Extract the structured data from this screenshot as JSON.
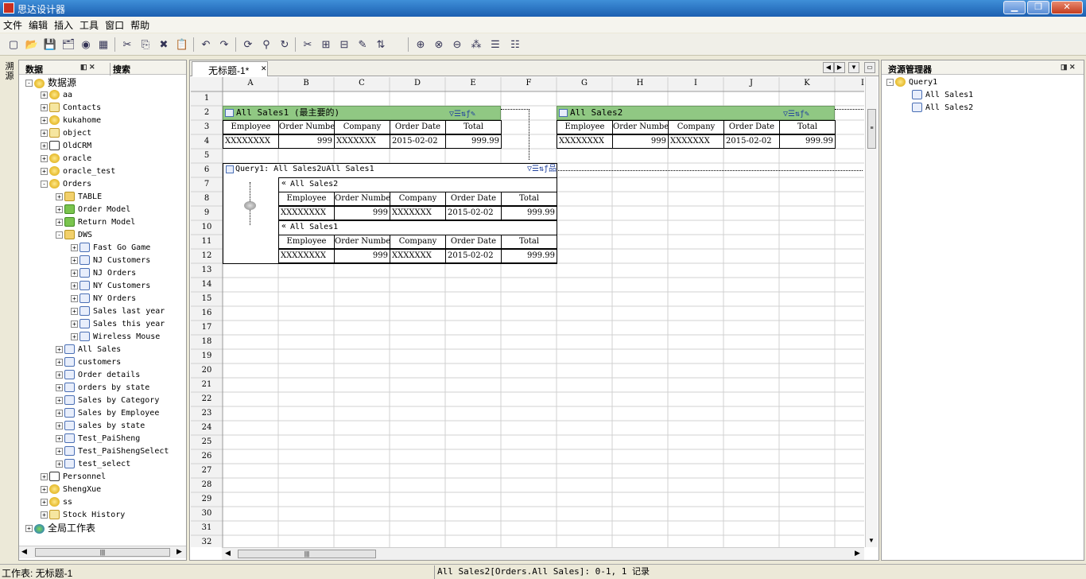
{
  "window": {
    "title": "思达设计器",
    "min_label": "▁",
    "max_label": "❐",
    "close_label": "✕"
  },
  "menu": [
    "文件",
    "编辑",
    "插入",
    "工具",
    "窗口",
    "帮助"
  ],
  "toolbar": [
    "new-icon",
    "open-icon",
    "save-icon",
    "save-all-icon",
    "preview-icon",
    "print-icon",
    "cut-icon",
    "copy-icon",
    "delete-icon",
    "paste-icon",
    "undo-icon",
    "redo-icon",
    "refresh-icon",
    "tree-icon",
    "reload-icon",
    "filter-icon",
    "grid-add-icon",
    "grid-sub-icon",
    "grid-edit-icon",
    "grid-sort-icon",
    "union-icon",
    "intersect-icon",
    "minus-icon",
    "split-icon",
    "table-icon",
    "table2-icon"
  ],
  "left_sidetab": "溯源",
  "data_panel": {
    "tab_data": "数据",
    "tab_search": "搜索",
    "tree": [
      {
        "l": 0,
        "e": "-",
        "i": "db",
        "t": "数据源"
      },
      {
        "l": 1,
        "e": "+",
        "i": "db",
        "t": "aa"
      },
      {
        "l": 1,
        "e": "+",
        "i": "ct",
        "t": "Contacts"
      },
      {
        "l": 1,
        "e": "+",
        "i": "db",
        "t": "kukahome"
      },
      {
        "l": 1,
        "e": "+",
        "i": "ct",
        "t": "object"
      },
      {
        "l": 1,
        "e": "+",
        "i": "xl",
        "t": "OldCRM"
      },
      {
        "l": 1,
        "e": "+",
        "i": "db",
        "t": "oracle"
      },
      {
        "l": 1,
        "e": "+",
        "i": "db",
        "t": "oracle_test"
      },
      {
        "l": 1,
        "e": "-",
        "i": "db",
        "t": "Orders"
      },
      {
        "l": 2,
        "e": "+",
        "i": "fo",
        "t": "TABLE"
      },
      {
        "l": 2,
        "e": "+",
        "i": "fg",
        "t": "Order Model"
      },
      {
        "l": 2,
        "e": "+",
        "i": "fg",
        "t": "Return Model"
      },
      {
        "l": 2,
        "e": "-",
        "i": "fo",
        "t": "DWS"
      },
      {
        "l": 3,
        "e": "+",
        "i": "tb2",
        "t": "Fast Go Game"
      },
      {
        "l": 3,
        "e": "+",
        "i": "tb2",
        "t": "NJ Customers"
      },
      {
        "l": 3,
        "e": "+",
        "i": "tb2",
        "t": "NJ Orders"
      },
      {
        "l": 3,
        "e": "+",
        "i": "tb2",
        "t": "NY Customers"
      },
      {
        "l": 3,
        "e": "+",
        "i": "tb2",
        "t": "NY Orders"
      },
      {
        "l": 3,
        "e": "+",
        "i": "tb2",
        "t": "Sales last year"
      },
      {
        "l": 3,
        "e": "+",
        "i": "tb2",
        "t": "Sales this year"
      },
      {
        "l": 3,
        "e": "+",
        "i": "tb2",
        "t": "Wireless Mouse"
      },
      {
        "l": 2,
        "e": "+",
        "i": "tb2",
        "t": "All Sales"
      },
      {
        "l": 2,
        "e": "+",
        "i": "tb2",
        "t": "customers"
      },
      {
        "l": 2,
        "e": "+",
        "i": "tb2",
        "t": "Order details"
      },
      {
        "l": 2,
        "e": "+",
        "i": "tb2",
        "t": "orders by state"
      },
      {
        "l": 2,
        "e": "+",
        "i": "tb2",
        "t": "Sales by Category"
      },
      {
        "l": 2,
        "e": "+",
        "i": "tb2",
        "t": "Sales by Employee"
      },
      {
        "l": 2,
        "e": "+",
        "i": "tb2",
        "t": "sales by state"
      },
      {
        "l": 2,
        "e": "+",
        "i": "tb2",
        "t": "Test_PaiSheng"
      },
      {
        "l": 2,
        "e": "+",
        "i": "tb2",
        "t": "Test_PaiShengSelect"
      },
      {
        "l": 2,
        "e": "+",
        "i": "tb2",
        "t": "test_select"
      },
      {
        "l": 1,
        "e": "+",
        "i": "xl",
        "t": "Personnel"
      },
      {
        "l": 1,
        "e": "+",
        "i": "db",
        "t": "ShengXue"
      },
      {
        "l": 1,
        "e": "+",
        "i": "db",
        "t": "ss"
      },
      {
        "l": 1,
        "e": "+",
        "i": "ct",
        "t": "Stock History"
      },
      {
        "l": 0,
        "e": "+",
        "i": "gl",
        "t": "全局工作表"
      }
    ]
  },
  "editor": {
    "tab_title": "无标题-1*",
    "columns": [
      "A",
      "B",
      "C",
      "D",
      "E",
      "F",
      "G",
      "H",
      "I",
      "J",
      "K",
      "I"
    ],
    "rows": [
      "1",
      "2",
      "3",
      "4",
      "5",
      "6",
      "7",
      "8",
      "9",
      "10",
      "11",
      "12",
      "13",
      "14",
      "15",
      "16",
      "17",
      "18",
      "19",
      "20",
      "21",
      "22",
      "23",
      "24",
      "25",
      "26",
      "27",
      "28",
      "29",
      "30",
      "31",
      "32"
    ],
    "fields": [
      "Employee",
      "Order Number",
      "Company",
      "Order Date",
      "Total"
    ],
    "record": [
      "XXXXXXXX",
      "999",
      "XXXXXXX",
      "2015-02-02",
      "999.99"
    ],
    "ds1_title": "All Sales1 (最主要的)",
    "ds2_title": "All Sales2",
    "query_title": "Query1: All Sales2∪All Sales1",
    "sub1_title": "All Sales2",
    "sub2_title": "All Sales1"
  },
  "resources": {
    "title": "资源管理器",
    "items": [
      {
        "l": 0,
        "t": "Query1"
      },
      {
        "l": 1,
        "t": "All Sales1"
      },
      {
        "l": 1,
        "t": "All Sales2"
      }
    ]
  },
  "status": {
    "left": "工作表: 无标题-1",
    "right": "All Sales2[Orders.All Sales]: 0-1, 1 记录"
  }
}
